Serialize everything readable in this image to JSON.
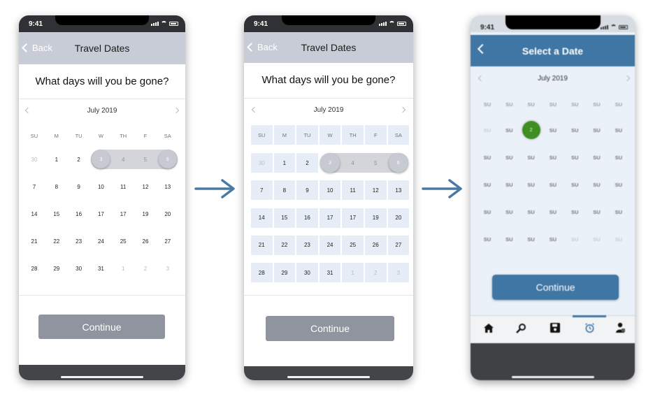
{
  "phones": [
    {
      "status_time": "9:41",
      "nav": {
        "back_label": "Back",
        "title": "Travel Dates"
      },
      "question": "What days will you be gone?",
      "month": "July 2019",
      "weekdays": [
        "SU",
        "M",
        "TU",
        "W",
        "TH",
        "F",
        "SA"
      ],
      "weeks": [
        [
          "30",
          "1",
          "2",
          "3",
          "4",
          "5",
          "6"
        ],
        [
          "7",
          "8",
          "9",
          "10",
          "11",
          "12",
          "13"
        ],
        [
          "14",
          "15",
          "16",
          "17",
          "17",
          "19",
          "20"
        ],
        [
          "21",
          "22",
          "23",
          "24",
          "25",
          "26",
          "27"
        ],
        [
          "28",
          "29",
          "30",
          "31",
          "1",
          "2",
          "3"
        ]
      ],
      "continue_label": "Continue"
    },
    {
      "status_time": "9:41",
      "nav": {
        "back_label": "Back",
        "title": "Travel Dates"
      },
      "question": "What days will you be gone?",
      "month": "July 2019",
      "weekdays": [
        "SU",
        "M",
        "TU",
        "W",
        "TH",
        "F",
        "SA"
      ],
      "weeks": [
        [
          "30",
          "1",
          "2",
          "3",
          "4",
          "5",
          "6"
        ],
        [
          "7",
          "8",
          "9",
          "10",
          "11",
          "12",
          "13"
        ],
        [
          "14",
          "15",
          "16",
          "17",
          "17",
          "19",
          "20"
        ],
        [
          "21",
          "22",
          "23",
          "24",
          "25",
          "26",
          "27"
        ],
        [
          "28",
          "29",
          "30",
          "31",
          "1",
          "2",
          "3"
        ]
      ],
      "continue_label": "Continue"
    },
    {
      "status_time": "9:41",
      "nav": {
        "title": "Select a Date"
      },
      "month": "July 2019",
      "weekdays": [
        "SU",
        "SU",
        "SU",
        "SU",
        "SU",
        "SU",
        "SU"
      ],
      "weeks": [
        [
          "SU",
          "SU",
          "2",
          "SU",
          "SU",
          "SU",
          "SU"
        ],
        [
          "SU",
          "SU",
          "SU",
          "SU",
          "SU",
          "SU",
          "SU"
        ],
        [
          "SU",
          "SU",
          "SU",
          "SU",
          "SU",
          "SU",
          "SU"
        ],
        [
          "SU",
          "SU",
          "SU",
          "SU",
          "SU",
          "SU",
          "SU"
        ],
        [
          "SU",
          "SU",
          "SU",
          "SU",
          "SU",
          "SU",
          "SU"
        ]
      ],
      "selected_day": "2",
      "continue_label": "Continue",
      "tabs": [
        "home-icon",
        "search-icon",
        "save-icon",
        "alarm-icon",
        "profile-icon"
      ]
    }
  ],
  "colors": {
    "nav_grey": "#c8ccd6",
    "nav_blue": "#3f76a3",
    "button_grey": "#8f949e",
    "button_blue": "#3f76a3",
    "selected_green": "#3e8e21",
    "arrow": "#4a7aa3"
  }
}
